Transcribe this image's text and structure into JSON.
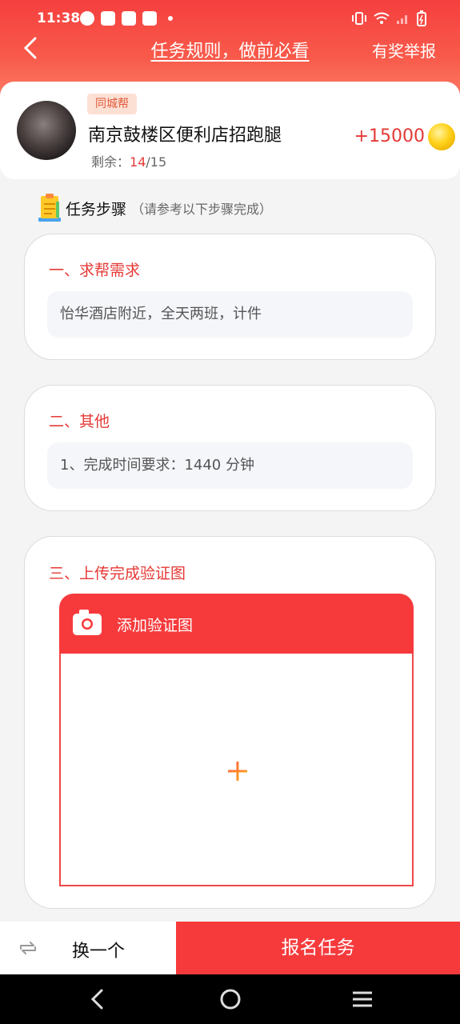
{
  "status_bar": {
    "time": "11:38",
    "left_icons": [
      "clock-icon",
      "mail-icon",
      "mail-icon",
      "mail-icon",
      "dot-icon"
    ],
    "right_icons": [
      "vibrate-icon",
      "wifi-icon",
      "signal-icon",
      "battery-icon"
    ]
  },
  "navbar": {
    "back_icon": "chevron-left-icon",
    "title": "任务规则，做前必看",
    "report_label": "有奖举报"
  },
  "task": {
    "tag": "同城帮",
    "title": "南京鼓楼区便利店招跑腿",
    "remaining_label": "剩余：",
    "remaining_current": "14",
    "remaining_total": "/15",
    "reward": "+15000",
    "reward_icon": "gold-coin-icon"
  },
  "steps": {
    "title": "任务步骤",
    "subtitle": "（请参考以下步骤完成）"
  },
  "sections": [
    {
      "title": "一、求帮需求",
      "content": "怡华酒店附近，全天两班，计件"
    },
    {
      "title": "二、其他",
      "content": "1、完成时间要求：1440 分钟"
    },
    {
      "title": "三、上传完成验证图",
      "upload_label": "添加验证图"
    }
  ],
  "actions": {
    "switch_label": "换一个",
    "signup_label": "报名任务"
  },
  "colors": {
    "accent": "#f63a3c",
    "section_title": "#e53935",
    "tag_bg": "#fde0d4"
  }
}
